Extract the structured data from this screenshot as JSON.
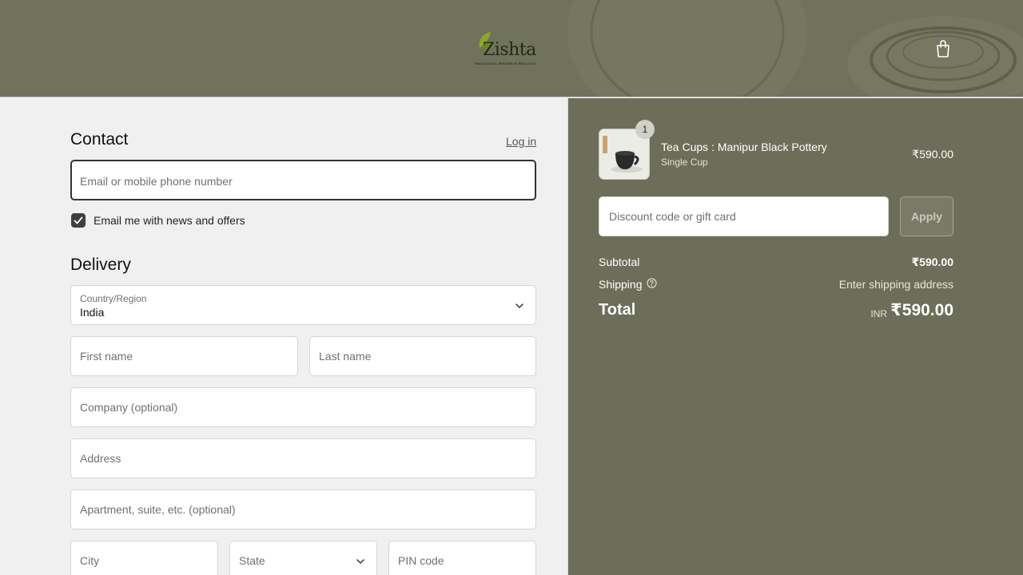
{
  "header": {
    "brand_name": "Zishta",
    "brand_tagline": "TRADITIONAL WISDOM IN PRACTICE",
    "cart_icon": "shopping-bag-icon"
  },
  "contact": {
    "title": "Contact",
    "login_label": "Log in",
    "email_placeholder": "Email or mobile phone number",
    "newsletter_label": "Email me with news and offers",
    "newsletter_checked": true
  },
  "delivery": {
    "title": "Delivery",
    "country_label": "Country/Region",
    "country_value": "India",
    "first_name_placeholder": "First name",
    "last_name_placeholder": "Last name",
    "company_placeholder": "Company (optional)",
    "address_placeholder": "Address",
    "apartment_placeholder": "Apartment, suite, etc. (optional)",
    "city_placeholder": "City",
    "state_placeholder": "State",
    "pin_placeholder": "PIN code"
  },
  "summary": {
    "item": {
      "quantity": "1",
      "name": "Tea Cups : Manipur Black Pottery",
      "variant": "Single Cup",
      "price": "₹590.00"
    },
    "discount_placeholder": "Discount code or gift card",
    "apply_label": "Apply",
    "subtotal_label": "Subtotal",
    "subtotal_value": "₹590.00",
    "shipping_label": "Shipping",
    "shipping_value": "Enter shipping address",
    "total_label": "Total",
    "total_currency": "INR",
    "total_value": "₹590.00"
  },
  "colors": {
    "header_bg": "#71725c",
    "summary_bg": "#6d6e59",
    "form_bg": "#f0f0f0"
  }
}
